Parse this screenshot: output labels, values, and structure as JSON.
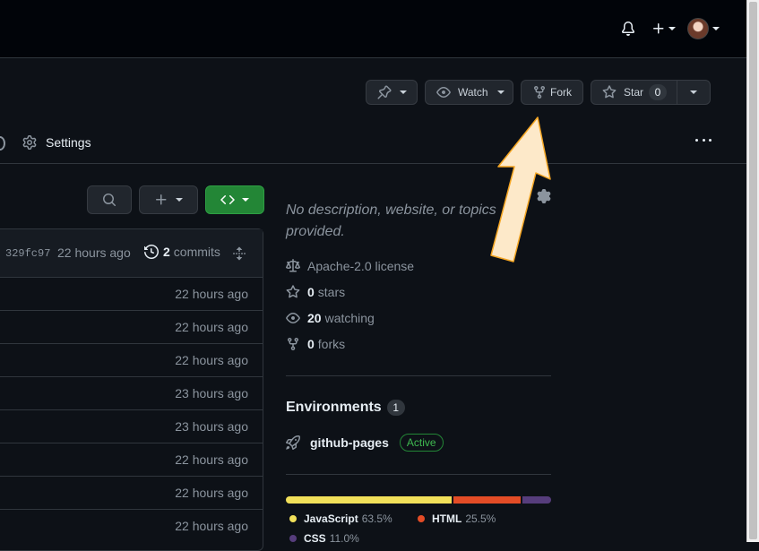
{
  "header": {
    "icons": [
      "bell-icon",
      "plus-icon",
      "avatar"
    ]
  },
  "repo_actions": {
    "watch_label": "Watch",
    "fork_label": "Fork",
    "star_label": "Star",
    "star_count": "0"
  },
  "tabs": {
    "settings_label": "Settings"
  },
  "commit_bar": {
    "sha": "329fc97",
    "time": "22 hours ago",
    "commits_count": "2",
    "commits_label": "commits"
  },
  "file_rows": [
    {
      "time": "22 hours ago"
    },
    {
      "time": "22 hours ago"
    },
    {
      "time": "22 hours ago"
    },
    {
      "time": "23 hours ago"
    },
    {
      "time": "23 hours ago"
    },
    {
      "time": "22 hours ago"
    },
    {
      "time": "22 hours ago"
    },
    {
      "time": "22 hours ago"
    }
  ],
  "about": {
    "description": "No description, website, or topics provided.",
    "license": "Apache-2.0 license",
    "stars_count": "0",
    "stars_label": "stars",
    "watching_count": "20",
    "watching_label": "watching",
    "forks_count": "0",
    "forks_label": "forks"
  },
  "environments": {
    "title": "Environments",
    "count": "1",
    "name": "github-pages",
    "status": "Active"
  },
  "languages": [
    {
      "name": "JavaScript",
      "percent": "63.5%",
      "value": 63.5,
      "color": "#f1e05a"
    },
    {
      "name": "HTML",
      "percent": "25.5%",
      "value": 25.5,
      "color": "#e34c26"
    },
    {
      "name": "CSS",
      "percent": "11.0%",
      "value": 11.0,
      "color": "#563d7c"
    }
  ],
  "colors": {
    "accent_green": "#238636",
    "annotation_arrow_fill": "#fde9c9",
    "annotation_arrow_stroke": "#f5a623"
  }
}
